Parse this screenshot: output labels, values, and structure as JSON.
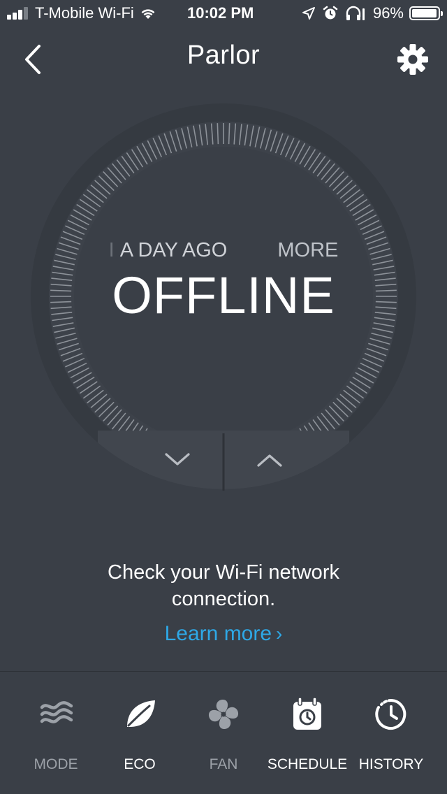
{
  "status_bar": {
    "carrier": "T-Mobile Wi-Fi",
    "time": "10:02 PM",
    "battery_percent": "96%",
    "battery_level": 0.96,
    "icons": [
      "signal-bars-icon",
      "wifi-icon",
      "location-arrow-icon",
      "alarm-icon",
      "headphones-icon",
      "battery-icon"
    ]
  },
  "nav": {
    "title": "Parlor",
    "back_icon": "chevron-left-icon",
    "settings_icon": "gear-icon"
  },
  "dial": {
    "carousel_left": "A DAY AGO",
    "carousel_right": "MORE",
    "status": "OFFLINE",
    "down_icon": "chevron-down-icon",
    "up_icon": "chevron-up-icon"
  },
  "message": {
    "line1": "Check your Wi-Fi network",
    "line2": "connection.",
    "link": "Learn more",
    "link_color": "#2ea8e6"
  },
  "toolbar": {
    "items": [
      {
        "label": "MODE",
        "icon": "mode-waves-icon",
        "active": false
      },
      {
        "label": "ECO",
        "icon": "eco-leaf-icon",
        "active": true
      },
      {
        "label": "FAN",
        "icon": "fan-icon",
        "active": false
      },
      {
        "label": "SCHEDULE",
        "icon": "schedule-calendar-icon",
        "active": true
      },
      {
        "label": "HISTORY",
        "icon": "history-clock-icon",
        "active": true
      }
    ]
  },
  "colors": {
    "background": "#3a3f47",
    "accent": "#2ea8e6",
    "dim_text": "#9ca1a8"
  }
}
